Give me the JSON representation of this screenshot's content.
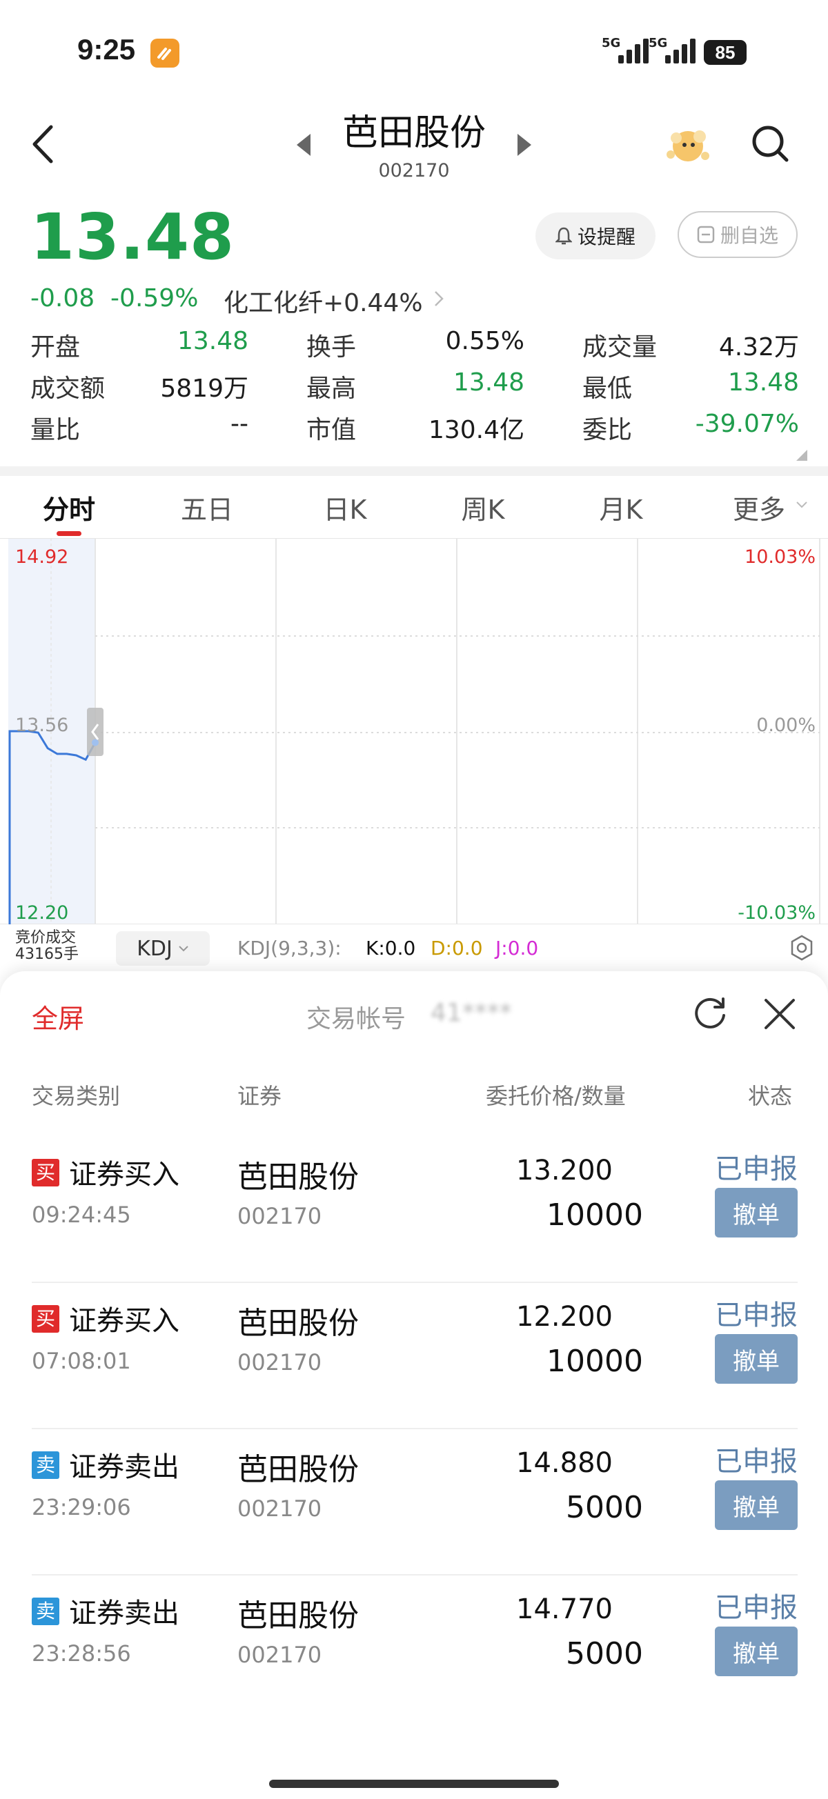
{
  "status_bar": {
    "time": "9:25",
    "network_1": "5G",
    "network_2": "5G",
    "battery": "85"
  },
  "header": {
    "stock_name": "芭田股份",
    "stock_code": "002170"
  },
  "quote": {
    "price": "13.48",
    "change": "-0.08",
    "change_pct": "-0.59%",
    "sector": "化工化纤+0.44%",
    "alert_button": "设提醒",
    "unfavorite_button": "删自选"
  },
  "stats": [
    {
      "label": "开盘",
      "value": "13.48",
      "color": "#1f9d4c"
    },
    {
      "label": "换手",
      "value": "0.55%",
      "color": "#1b1b1b"
    },
    {
      "label": "成交量",
      "value": "4.32万",
      "color": "#1b1b1b"
    },
    {
      "label": "成交额",
      "value": "5819万",
      "color": "#1b1b1b"
    },
    {
      "label": "最高",
      "value": "13.48",
      "color": "#1f9d4c"
    },
    {
      "label": "最低",
      "value": "13.48",
      "color": "#1f9d4c"
    },
    {
      "label": "量比",
      "value": "--",
      "color": "#1b1b1b"
    },
    {
      "label": "市值",
      "value": "130.4亿",
      "color": "#1b1b1b"
    },
    {
      "label": "委比",
      "value": "-39.07%",
      "color": "#1f9d4c"
    }
  ],
  "tabs": [
    "分时",
    "五日",
    "日K",
    "周K",
    "月K",
    "更多"
  ],
  "chart": {
    "y_top": "14.92",
    "y_mid": "13.56",
    "y_bot": "12.20",
    "pct_top": "10.03%",
    "pct_mid": "0.00%",
    "pct_bot": "-10.03%",
    "auction_label_1": "竞价成交",
    "auction_label_2": "43165手",
    "indicator": "KDJ",
    "indicator_params": "KDJ(9,3,3):",
    "k": "K:0.0",
    "d": "D:0.0",
    "j": "J:0.0"
  },
  "chart_data": {
    "type": "line",
    "title": "",
    "xlabel": "",
    "ylabel": "",
    "ylim": [
      12.2,
      14.92
    ],
    "x": [
      0,
      1,
      2,
      3,
      4,
      5,
      6,
      7,
      8,
      9
    ],
    "series": [
      {
        "values": [
          13.56,
          13.56,
          13.56,
          13.55,
          13.44,
          13.4,
          13.4,
          13.39,
          13.36,
          13.48
        ]
      }
    ]
  },
  "orders_panel": {
    "fullscreen_label": "全屏",
    "account_label": "交易帐号",
    "account_masked": "41****",
    "columns": [
      "交易类别",
      "证券",
      "委托价格/数量",
      "状态"
    ],
    "orders": [
      {
        "side": "买",
        "side_class": "buy",
        "type": "证券买入",
        "time": "09:24:45",
        "name": "芭田股份",
        "code": "002170",
        "price": "13.200",
        "qty": "10000",
        "status": "已申报",
        "action": "撤单"
      },
      {
        "side": "买",
        "side_class": "buy",
        "type": "证券买入",
        "time": "07:08:01",
        "name": "芭田股份",
        "code": "002170",
        "price": "12.200",
        "qty": "10000",
        "status": "已申报",
        "action": "撤单"
      },
      {
        "side": "卖",
        "side_class": "sell",
        "type": "证券卖出",
        "time": "23:29:06",
        "name": "芭田股份",
        "code": "002170",
        "price": "14.880",
        "qty": "5000",
        "status": "已申报",
        "action": "撤单"
      },
      {
        "side": "卖",
        "side_class": "sell",
        "type": "证券卖出",
        "time": "23:28:56",
        "name": "芭田股份",
        "code": "002170",
        "price": "14.770",
        "qty": "5000",
        "status": "已申报",
        "action": "撤单"
      }
    ]
  }
}
